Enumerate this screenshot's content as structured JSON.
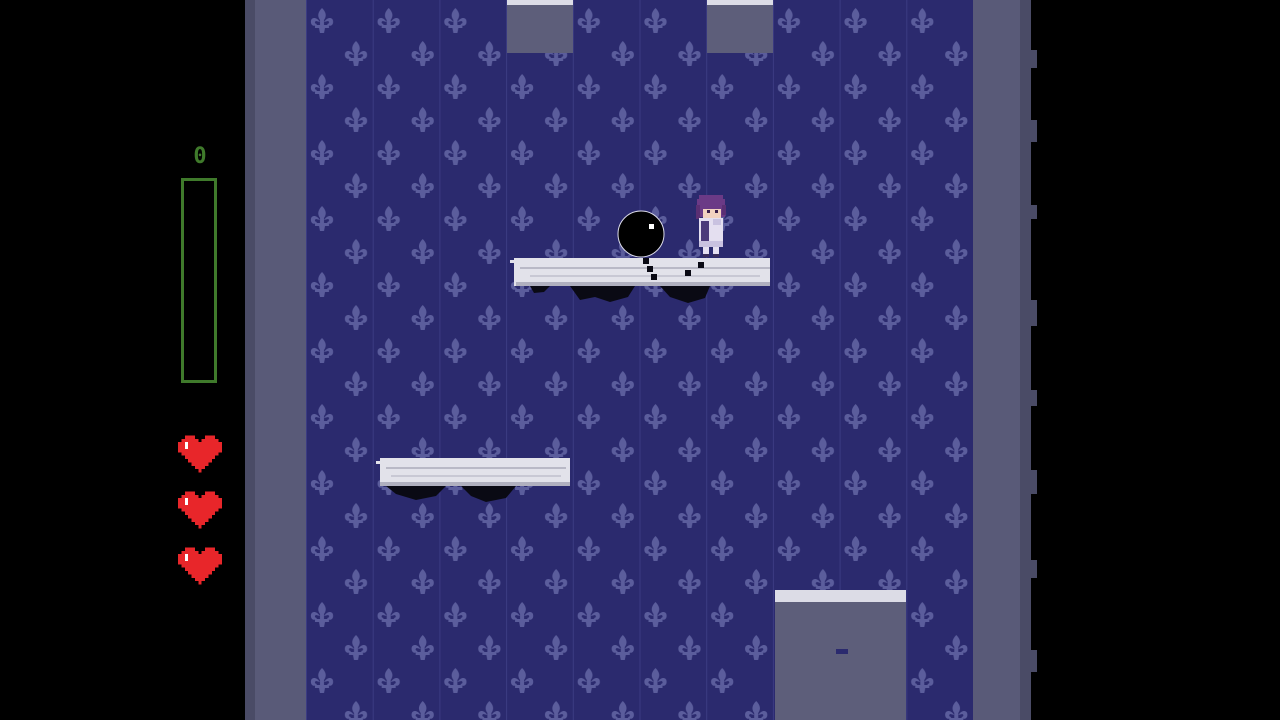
{
  "hud": {
    "score": "0",
    "meter_fill": 0,
    "hearts": [
      "full",
      "full",
      "full"
    ],
    "colors": {
      "meter": "#3f7a2b",
      "heart": "#e8262a",
      "heart_shine": "#ffffff"
    }
  },
  "scene": {
    "wallpaper_pattern": "fleur-de-lis",
    "colors": {
      "wallpaper_bg": "#2b2a6e",
      "wallpaper_motif": "#5b5d9c",
      "wall": "#595a78",
      "platform": "#e2e2ea",
      "shadow": "#0a0a14"
    }
  },
  "icons": {
    "heart": "heart-icon",
    "player": "player-character",
    "ball": "black-ball-enemy"
  }
}
